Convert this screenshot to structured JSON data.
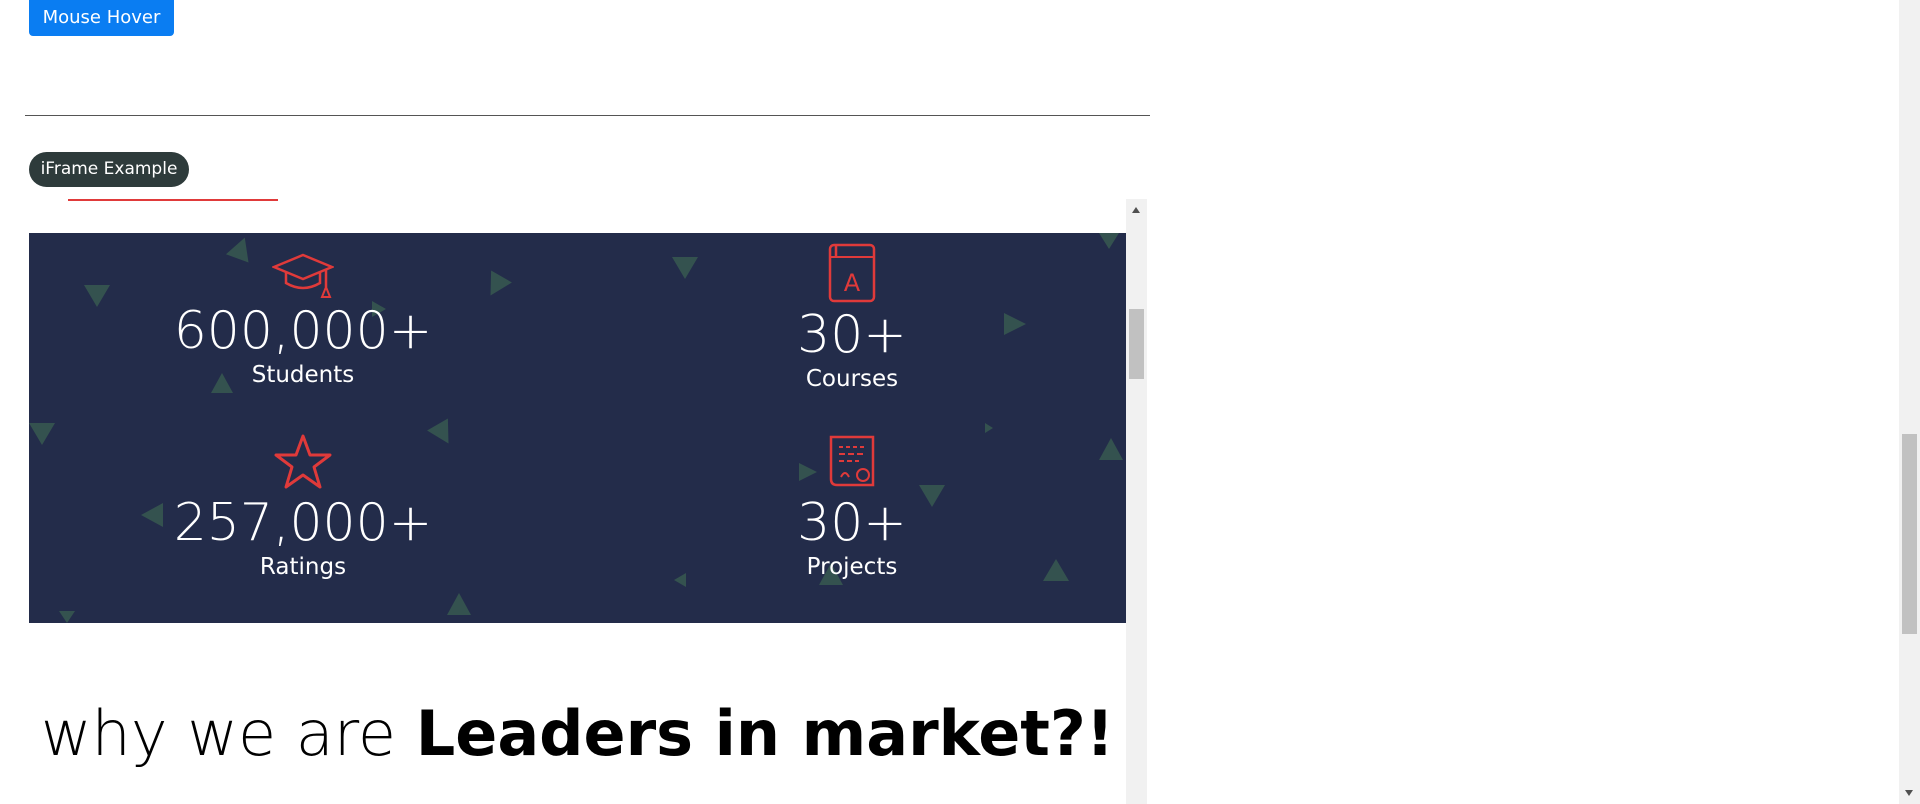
{
  "buttons": {
    "mouse_hover": "Mouse Hover"
  },
  "section": {
    "iframe_label": "iFrame Example"
  },
  "stats": [
    {
      "value": "600,000",
      "suffix": "+",
      "label": "Students",
      "icon": "graduation-cap-icon"
    },
    {
      "value": "30",
      "suffix": "+",
      "label": "Courses",
      "icon": "book-icon"
    },
    {
      "value": "257,000",
      "suffix": "+",
      "label": "Ratings",
      "icon": "star-icon"
    },
    {
      "value": "30",
      "suffix": "+",
      "label": "Projects",
      "icon": "certificate-icon"
    }
  ],
  "headline": {
    "light": "why we are ",
    "bold": "Leaders in market?!"
  },
  "colors": {
    "accent": "#0a7df2",
    "stats_bg": "#232c4a",
    "icon_red": "#e03a3a",
    "pill_bg": "#2e3b3b"
  }
}
